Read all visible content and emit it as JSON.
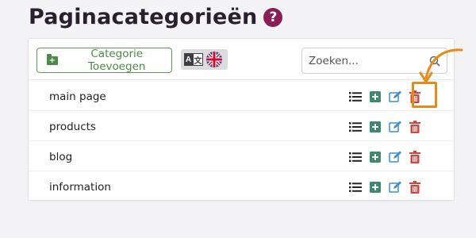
{
  "header": {
    "title": "Paginacategorieën",
    "help_glyph": "?"
  },
  "toolbar": {
    "add_label": "Categorie Toevoegen",
    "translate_glyph_a": "A",
    "translate_glyph_b": "文",
    "search_placeholder": "Zoeken..."
  },
  "categories": [
    {
      "label": "main page"
    },
    {
      "label": "products"
    },
    {
      "label": "blog"
    },
    {
      "label": "information"
    }
  ],
  "colors": {
    "title_help": "#8a1e58",
    "add_button": "#4c8a47",
    "list_icon": "#222222",
    "add_icon": "#3f8a6e",
    "edit_icon": "#3a8fd6",
    "delete_icon": "#d0453f",
    "callout": "#e88a1a"
  },
  "icons": [
    "help-icon",
    "folder-plus-icon",
    "translate-icon",
    "uk-flag-icon",
    "search-icon",
    "list-icon",
    "plus-square-icon",
    "edit-icon",
    "trash-icon"
  ]
}
